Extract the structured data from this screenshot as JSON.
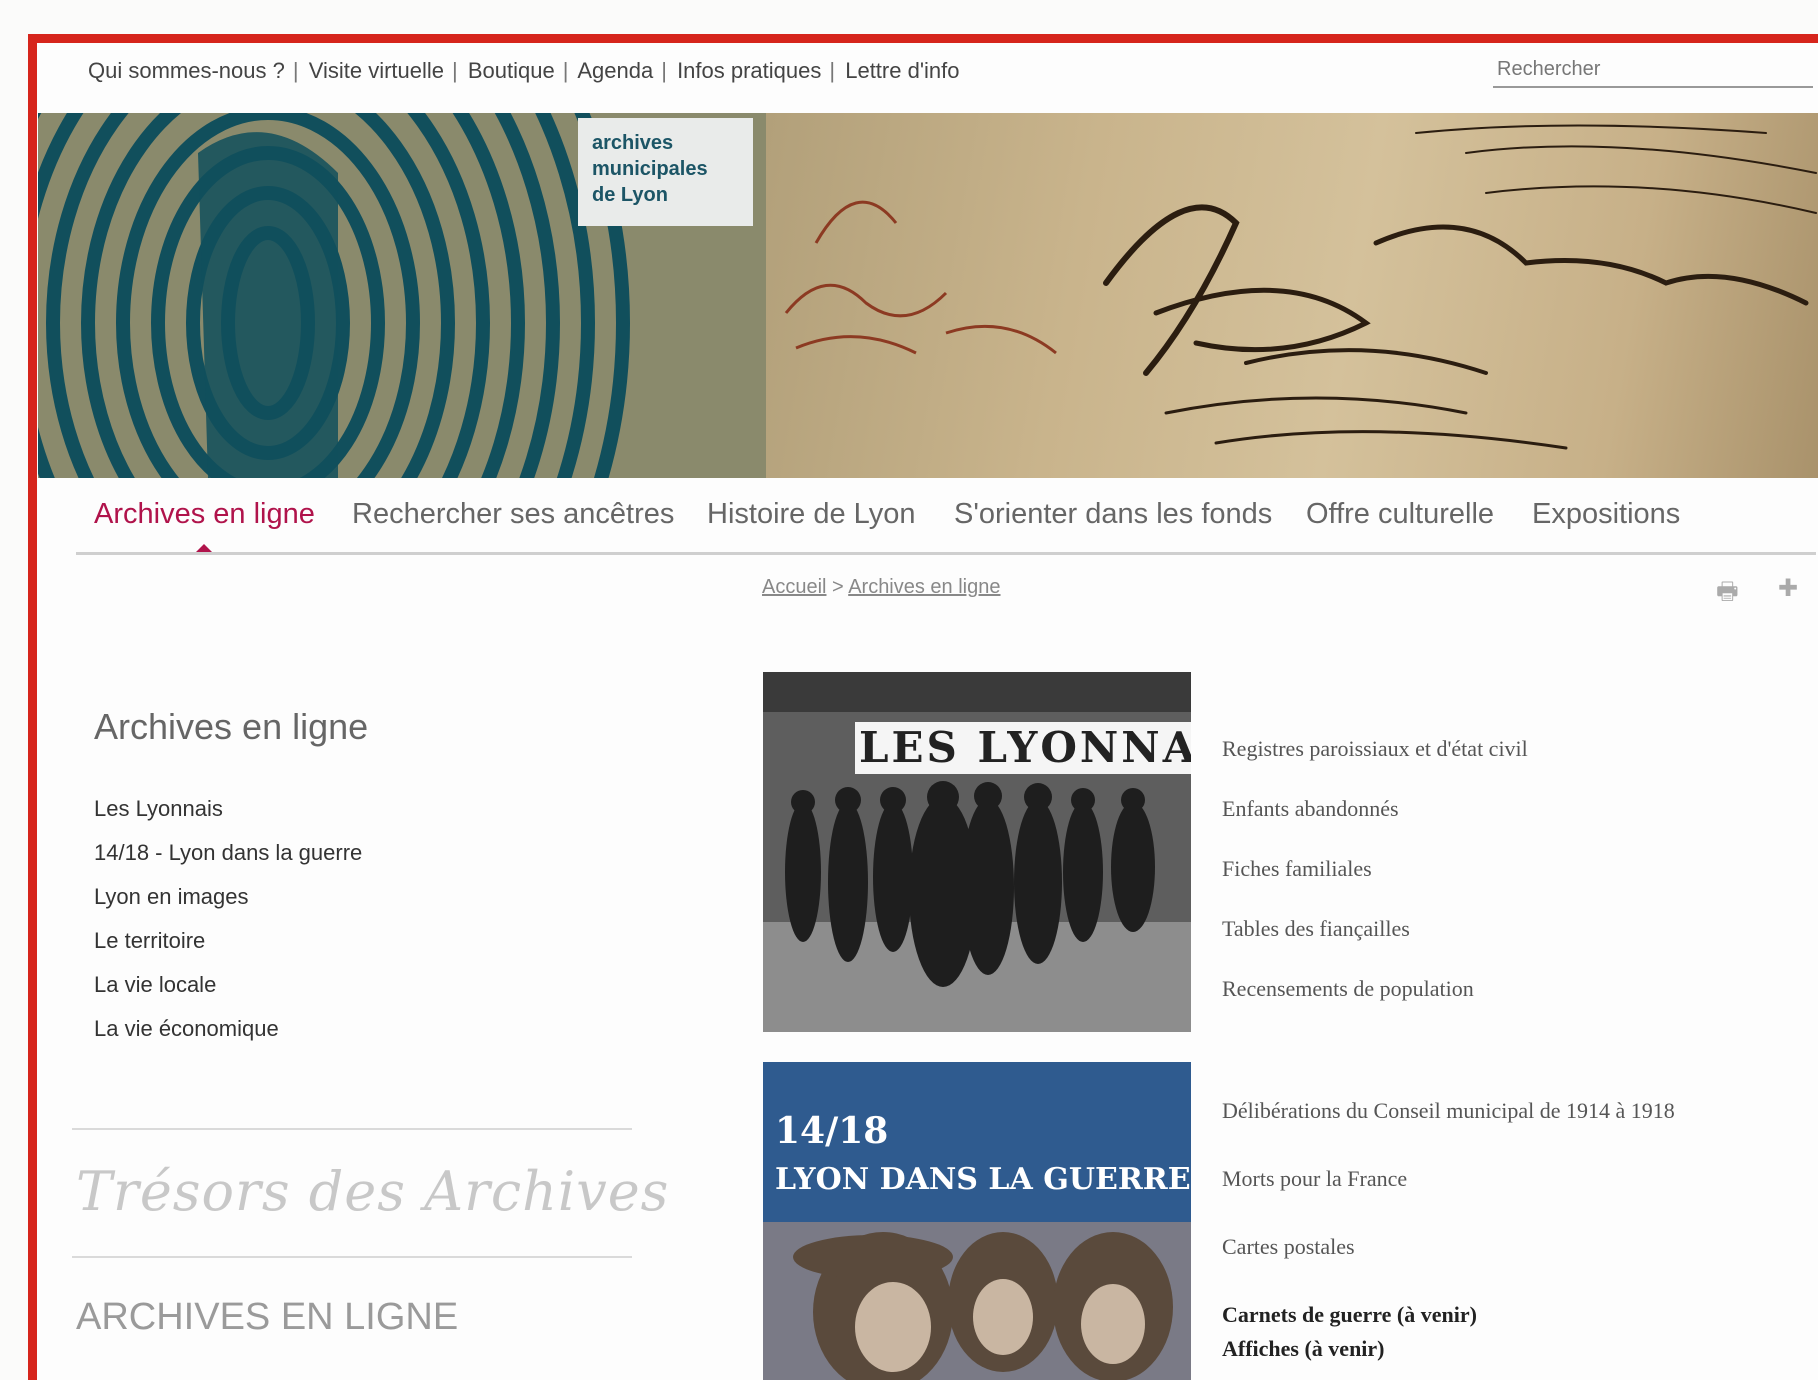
{
  "utility_bar": {
    "links": [
      "Qui sommes-nous ?",
      "Visite virtuelle",
      "Boutique",
      "Agenda",
      "Infos pratiques",
      "Lettre d'info"
    ],
    "separator": "|",
    "search_placeholder": "Rechercher"
  },
  "banner": {
    "logo_lines": [
      "archives",
      "municipales",
      "de Lyon"
    ]
  },
  "main_nav": {
    "items": [
      "Archives en ligne",
      "Rechercher ses ancêtres",
      "Histoire de Lyon",
      "S'orienter dans les fonds",
      "Offre culturelle",
      "Expositions"
    ],
    "active_index": 0,
    "active_color": "#b0134b"
  },
  "breadcrumb": {
    "home": "Accueil",
    "separator": ">",
    "current": "Archives en ligne"
  },
  "tools": {
    "print_icon": "print-icon",
    "share_icon": "plus-icon"
  },
  "sidebar": {
    "title": "Archives en ligne",
    "items": [
      "Les Lyonnais",
      "14/18 - Lyon dans la guerre",
      "Lyon en images",
      "Le territoire",
      "La vie locale",
      "La vie économique"
    ],
    "tresors_label": "Trésors des Archives",
    "archives_en_ligne_label": "ARCHIVES EN LIGNE"
  },
  "featured": [
    {
      "ribbon_text": "LES LYONNAIS",
      "links": [
        "Registres paroissiaux et d'état civil",
        "Enfants abandonnés",
        "Fiches familiales",
        "Tables des fiançailles",
        "Recensements de population"
      ]
    },
    {
      "title_line_1": "14/18",
      "title_line_2": "LYON DANS LA GUERRE",
      "links": [
        "Délibérations du Conseil municipal de 1914 à 1918",
        "Morts pour la France",
        "Cartes postales"
      ],
      "bold_links": [
        "Carnets de guerre (à venir)",
        "Affiches (à venir)"
      ]
    }
  ],
  "colors": {
    "frame_red": "#d6251c",
    "thumb2_blue": "#2f5b8f",
    "logo_teal": "#1c5566"
  }
}
